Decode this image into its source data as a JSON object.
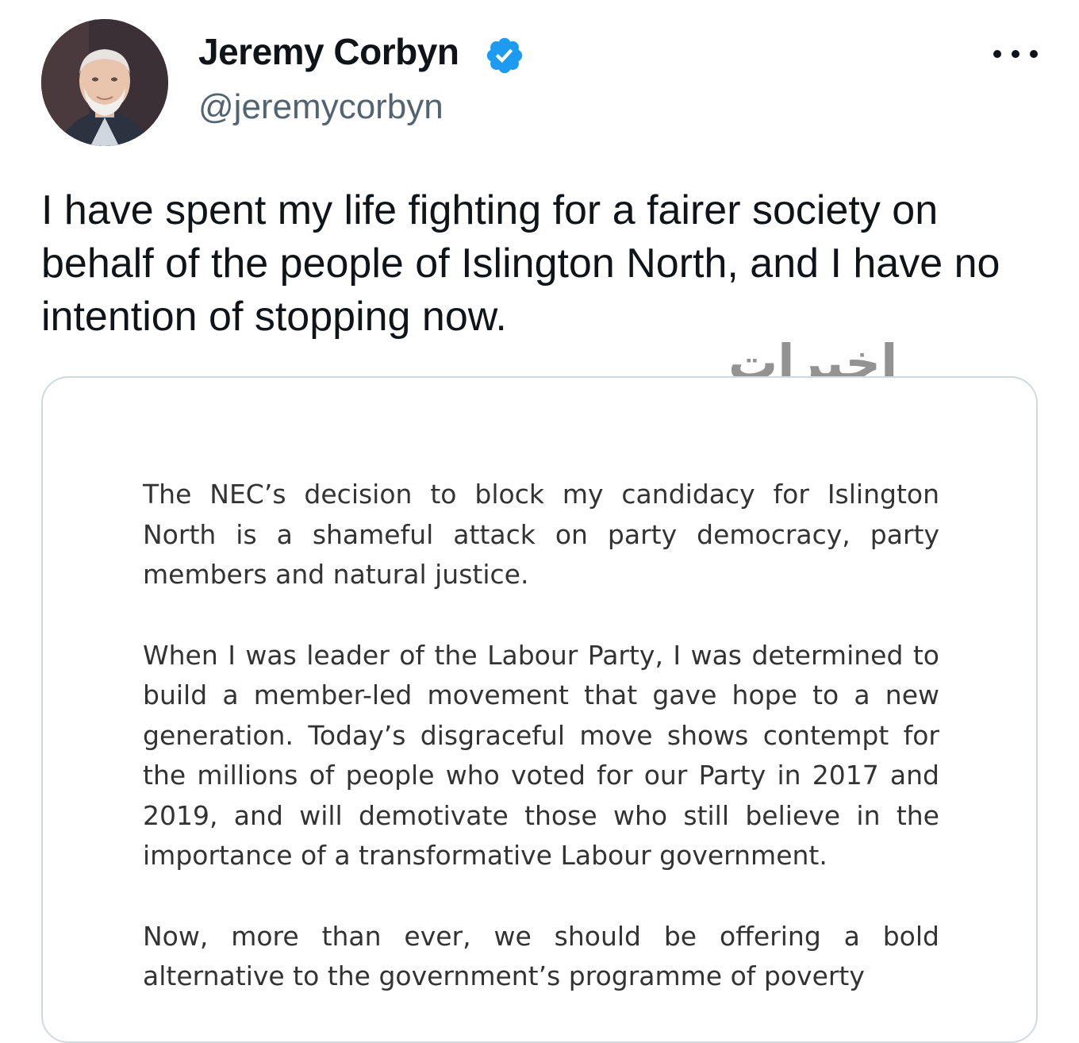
{
  "author": {
    "name": "Jeremy Corbyn",
    "handle": "@jeremycorbyn",
    "verified": true
  },
  "icons": {
    "verified": "verified-badge-icon",
    "more": "more-options-icon"
  },
  "colors": {
    "verified_blue": "#1d9bf0",
    "handle_gray": "#536471",
    "text": "#0f1419"
  },
  "tweet": {
    "text": "I have spent my life fighting for a fairer society on behalf of the people of Islington North, and I have no intention of stopping now."
  },
  "watermark": {
    "text": "اخبرات"
  },
  "attached_statement": {
    "paragraphs": [
      "The NEC’s decision to block my candidacy for Islington North is a shameful attack on party democracy, party members and natural justice.",
      "When I was leader of the Labour Party, I was determined to build a member-led movement that gave hope to a new generation. Today’s disgraceful move shows contempt for the millions of people who voted for our Party in 2017 and 2019, and will demotivate those who still believe in the importance of a transformative Labour government.",
      "Now, more than ever, we should be offering a bold alternative to the government’s programme of poverty"
    ]
  }
}
